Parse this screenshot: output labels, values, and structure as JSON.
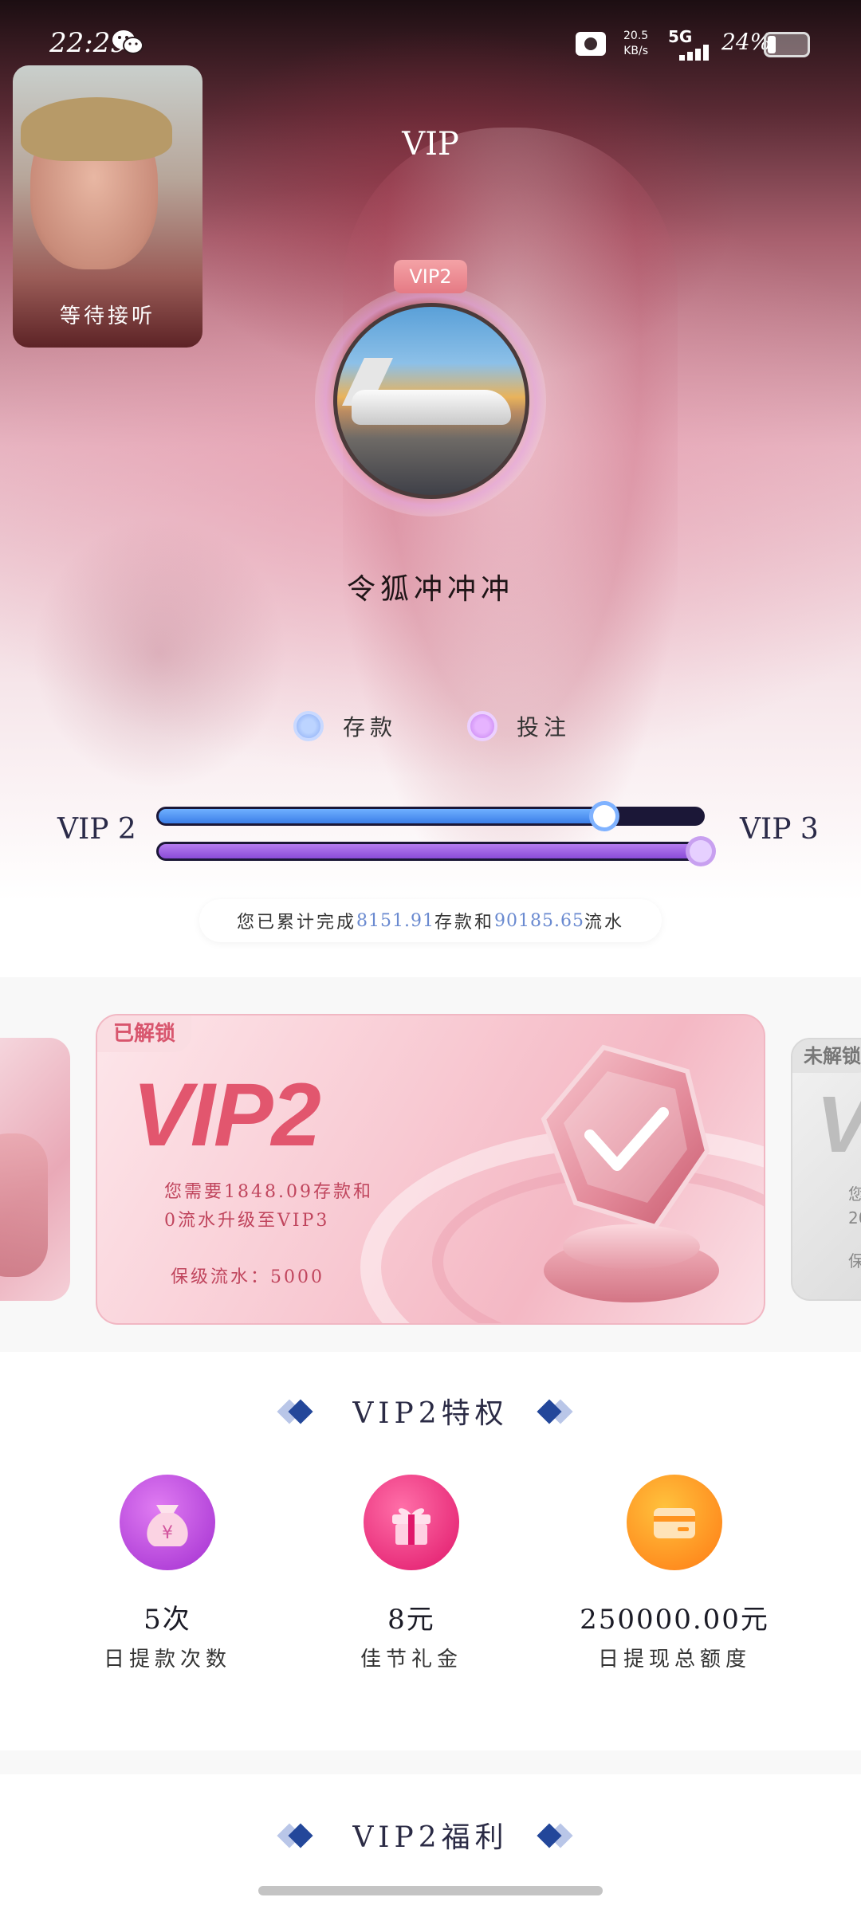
{
  "status_bar": {
    "time": "22:29",
    "net_speed_value": "20.5",
    "net_speed_unit": "KB/s",
    "network": "5G",
    "battery_text": "24%",
    "battery_level": 0.24,
    "icons": [
      "wechat-icon",
      "camera-icon",
      "signal-icon",
      "battery-icon"
    ]
  },
  "call_pip": {
    "label": "等待接听"
  },
  "header": {
    "title": "VIP"
  },
  "profile": {
    "badge": "VIP2",
    "nickname": "令狐冲冲冲"
  },
  "legend": {
    "deposit_label": "存款",
    "bet_label": "投注"
  },
  "progress": {
    "current_level": "VIP 2",
    "next_level": "VIP 3",
    "deposit_fraction": 0.82,
    "bet_fraction": 1.0,
    "colors": {
      "deposit": "#3b7ee8",
      "bet": "#8a4cd8",
      "track": "#1b1737"
    }
  },
  "summary": {
    "prefix": "您已累计完成",
    "deposit_amount": "8151.91",
    "middle": "存款和",
    "turnover_amount": "90185.65",
    "suffix": "流水"
  },
  "cards": {
    "main": {
      "status": "已解锁",
      "title": "VIP2",
      "requirement_line1": "您需要1848.09存款和",
      "requirement_line2": "0流水升级至VIP3",
      "keep_label": "保级流水：5000"
    },
    "next": {
      "status": "未解锁",
      "title": "V",
      "line1": "您",
      "line2": "20",
      "line3": "保"
    }
  },
  "privileges": {
    "title": "VIP2特权",
    "items": [
      {
        "value": "5次",
        "name": "日提款次数",
        "icon": "money-bag-icon"
      },
      {
        "value": "8元",
        "name": "佳节礼金",
        "icon": "gift-icon"
      },
      {
        "value": "250000.00元",
        "name": "日提现总额度",
        "icon": "wallet-icon"
      }
    ]
  },
  "welfare": {
    "title": "VIP2福利"
  },
  "theme": {
    "accent_pink": "#e2566e",
    "navy": "#2b2b45",
    "summary_number": "#6a8ad0"
  }
}
